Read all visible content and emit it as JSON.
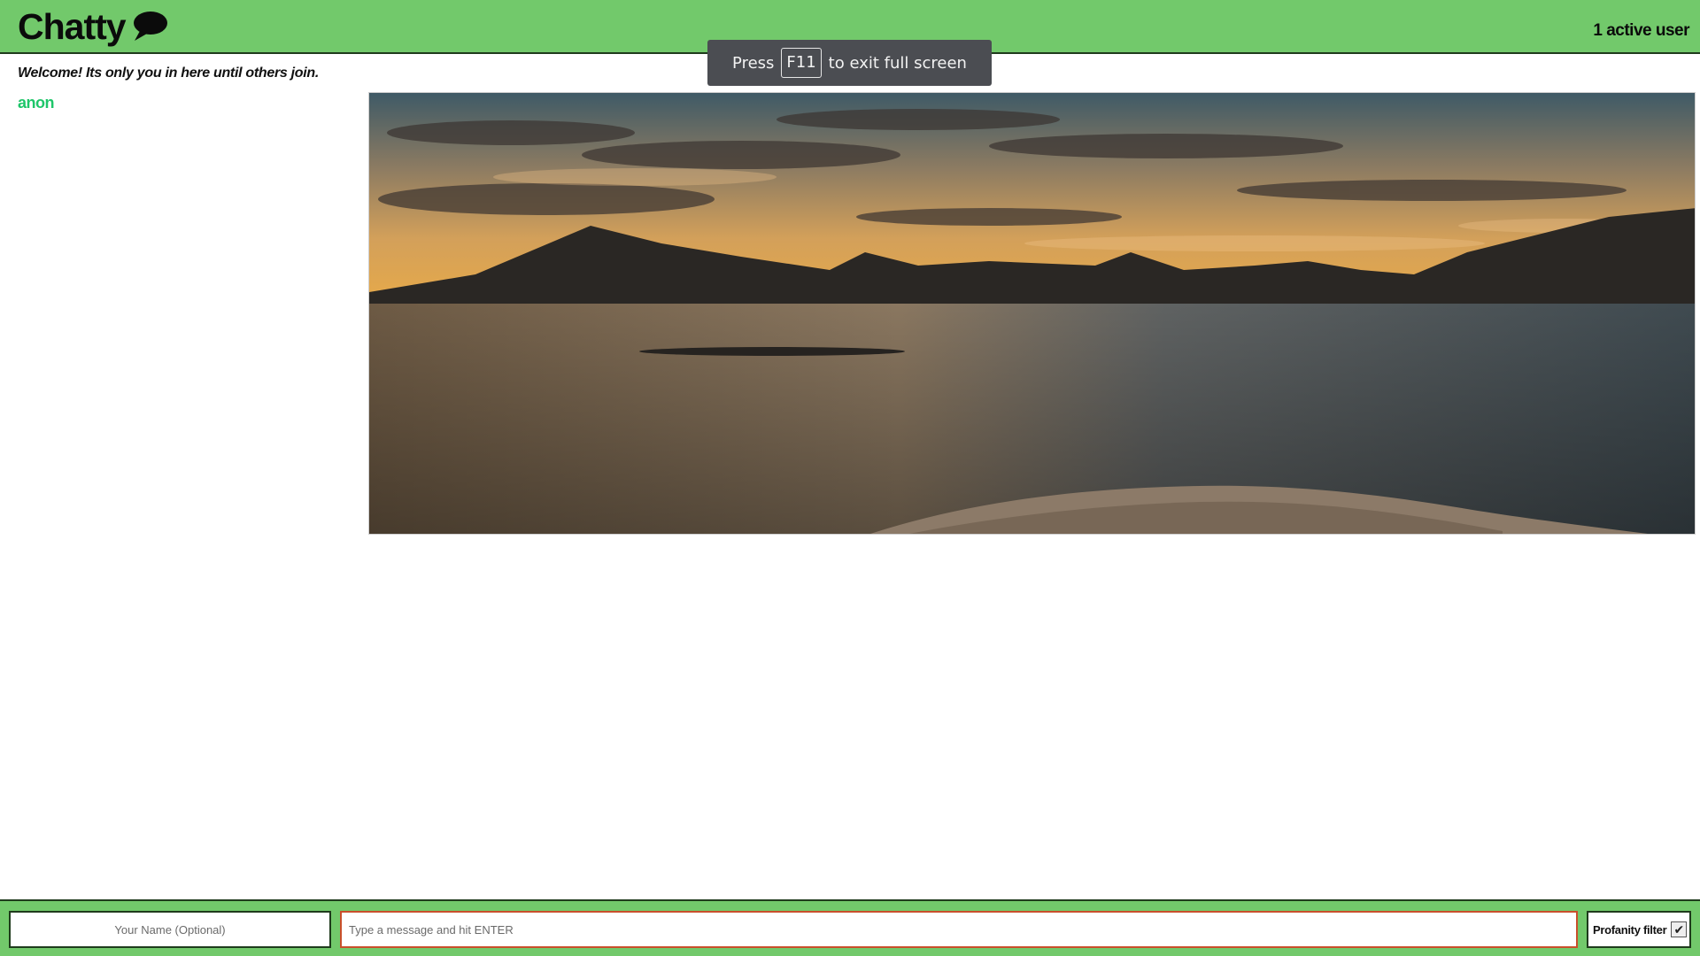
{
  "header": {
    "title": "Chatty",
    "logo_icon": "speech-bubble-icon",
    "active_users": "1 active user"
  },
  "fullscreen_toast": {
    "before": "Press",
    "key": "F11",
    "after": "to exit full screen"
  },
  "sidebar": {
    "welcome": "Welcome! Its only you in here until others join.",
    "users": [
      "anon"
    ]
  },
  "chat": {
    "image_subject": "landscape-lake-mountains-sunset"
  },
  "footer": {
    "name_placeholder": "Your Name (Optional)",
    "message_placeholder": "Type a message and hit ENTER",
    "profanity_label": "Profanity filter",
    "profanity_checked": true
  },
  "colors": {
    "accent_green": "#72c96b",
    "user_name": "#1fc66a",
    "message_border": "#c94f2b"
  }
}
